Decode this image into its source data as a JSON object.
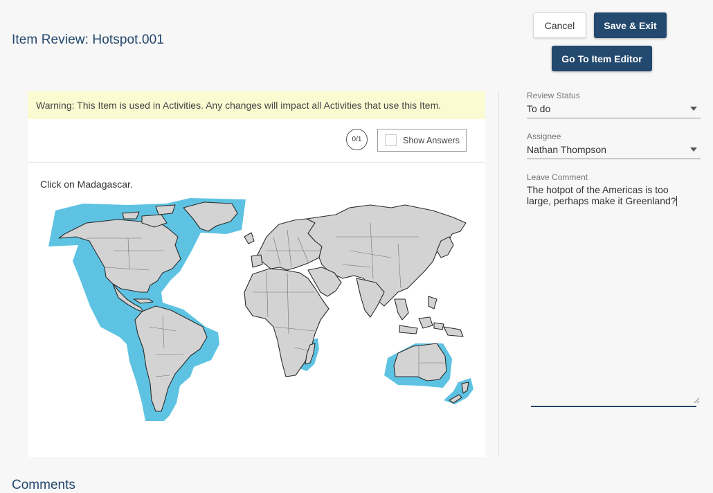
{
  "header": {
    "title": "Item Review: Hotspot.001",
    "cancel_label": "Cancel",
    "save_exit_label": "Save & Exit",
    "go_to_editor_label": "Go To Item Editor"
  },
  "item": {
    "warning": "Warning: This Item is used in Activities. Any changes will impact all Activities that use this Item.",
    "score": "0/1",
    "show_answers_label": "Show Answers",
    "show_answers_checked": false,
    "prompt": "Click on Madagascar."
  },
  "review": {
    "status_label": "Review Status",
    "status_value": "To do",
    "assignee_label": "Assignee",
    "assignee_value": "Nathan Thompson",
    "comment_label": "Leave Comment",
    "comment_value": "The hotpot of the Americas is too large, perhaps make it Greenland?"
  },
  "comments": {
    "heading": "Comments"
  },
  "colors": {
    "brand": "#24496e",
    "hotspot": "#5ec3e2",
    "warning_bg": "#fbfbd2"
  }
}
